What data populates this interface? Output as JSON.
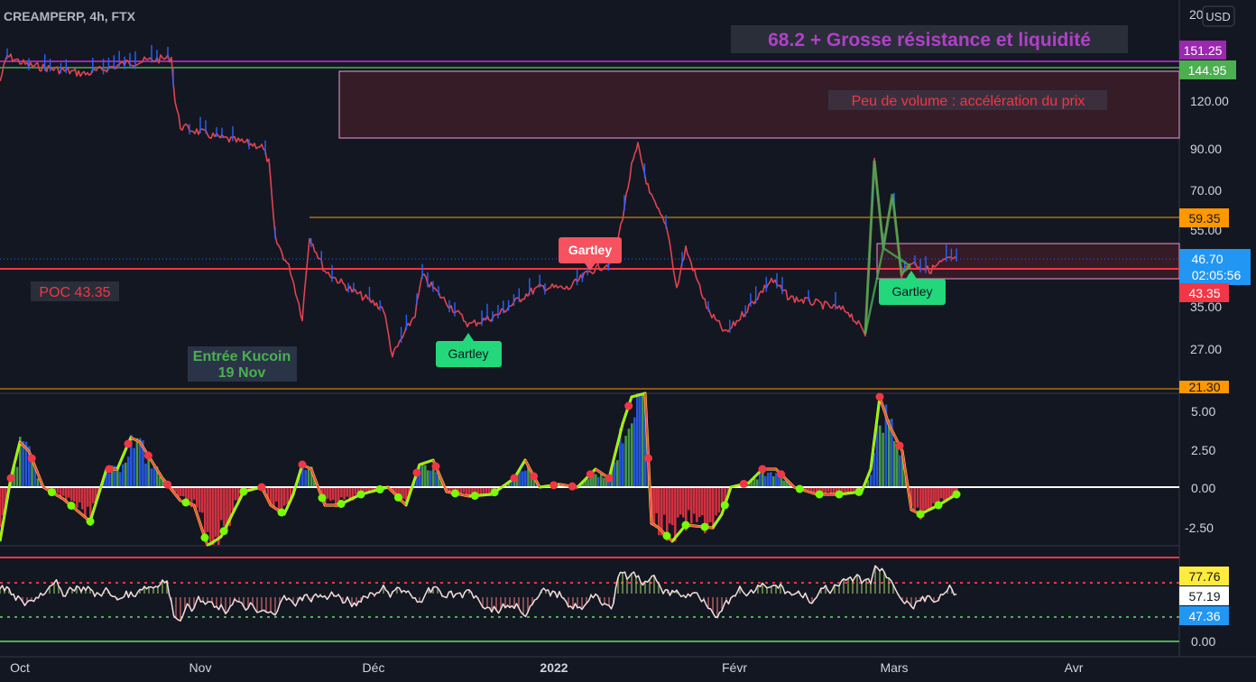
{
  "header": {
    "symbol_label": "CREAMPERP, 4h, FTX"
  },
  "scale_button": {
    "label": "USD"
  },
  "top_axis_partial": "20",
  "annotations": {
    "resistance_title": "68.2 + Grosse résistance et liquidité",
    "low_volume": "Peu de volume : accélération du prix",
    "poc": "POC 43.35",
    "entry_line1": "Entrée Kucoin",
    "entry_line2": "19 Nov",
    "gartley_1": "Gartley",
    "gartley_2": "Gartley",
    "gartley_3": "Gartley"
  },
  "price_badges": {
    "b151": "151.25",
    "b144": "144.95",
    "b59": "59.35",
    "b46": "46.70",
    "timer": "02:05:56",
    "b43": "43.35",
    "b21": "21.30"
  },
  "osc_badges": {
    "o77": "77.76",
    "o57": "57.19",
    "o47": "47.36"
  },
  "colors": {
    "background": "#131722",
    "up": "#2962ff",
    "down": "#f23645",
    "purple": "#9c27b0",
    "green": "#4caf50",
    "orange": "#ff9800",
    "badge_blue": "#2196f3"
  },
  "chart_data": [
    {
      "type": "line",
      "title": "CREAMPERP, 4h, FTX",
      "scale": "log",
      "ylim": [
        21,
        200
      ],
      "y_ticks": [
        "120.00",
        "90.00",
        "70.00",
        "55.00",
        "35.00",
        "27.00"
      ],
      "x_ticks": [
        "Oct",
        "Nov",
        "Déc",
        "2022",
        "Févr",
        "Mars",
        "Avr"
      ],
      "horizontal_levels": [
        151.25,
        144.95,
        59.35,
        43.35,
        21.3
      ],
      "current_price": 46.7,
      "series": [
        {
          "x": [
            "Oct",
            "Nov",
            "Déc",
            "2022",
            "Févr",
            "Mars"
          ],
          "y": [
            145,
            100,
            37,
            55,
            40,
            48
          ]
        }
      ]
    },
    {
      "type": "area",
      "y_ticks": [
        "5.00",
        "2.50",
        "0.00",
        "-2.50"
      ],
      "ylim": [
        -3.7,
        6
      ]
    },
    {
      "type": "line",
      "y_ticks": [
        "0.00"
      ],
      "levels": [
        77.76,
        57.19,
        47.36
      ],
      "ylim": [
        0,
        100
      ]
    }
  ]
}
